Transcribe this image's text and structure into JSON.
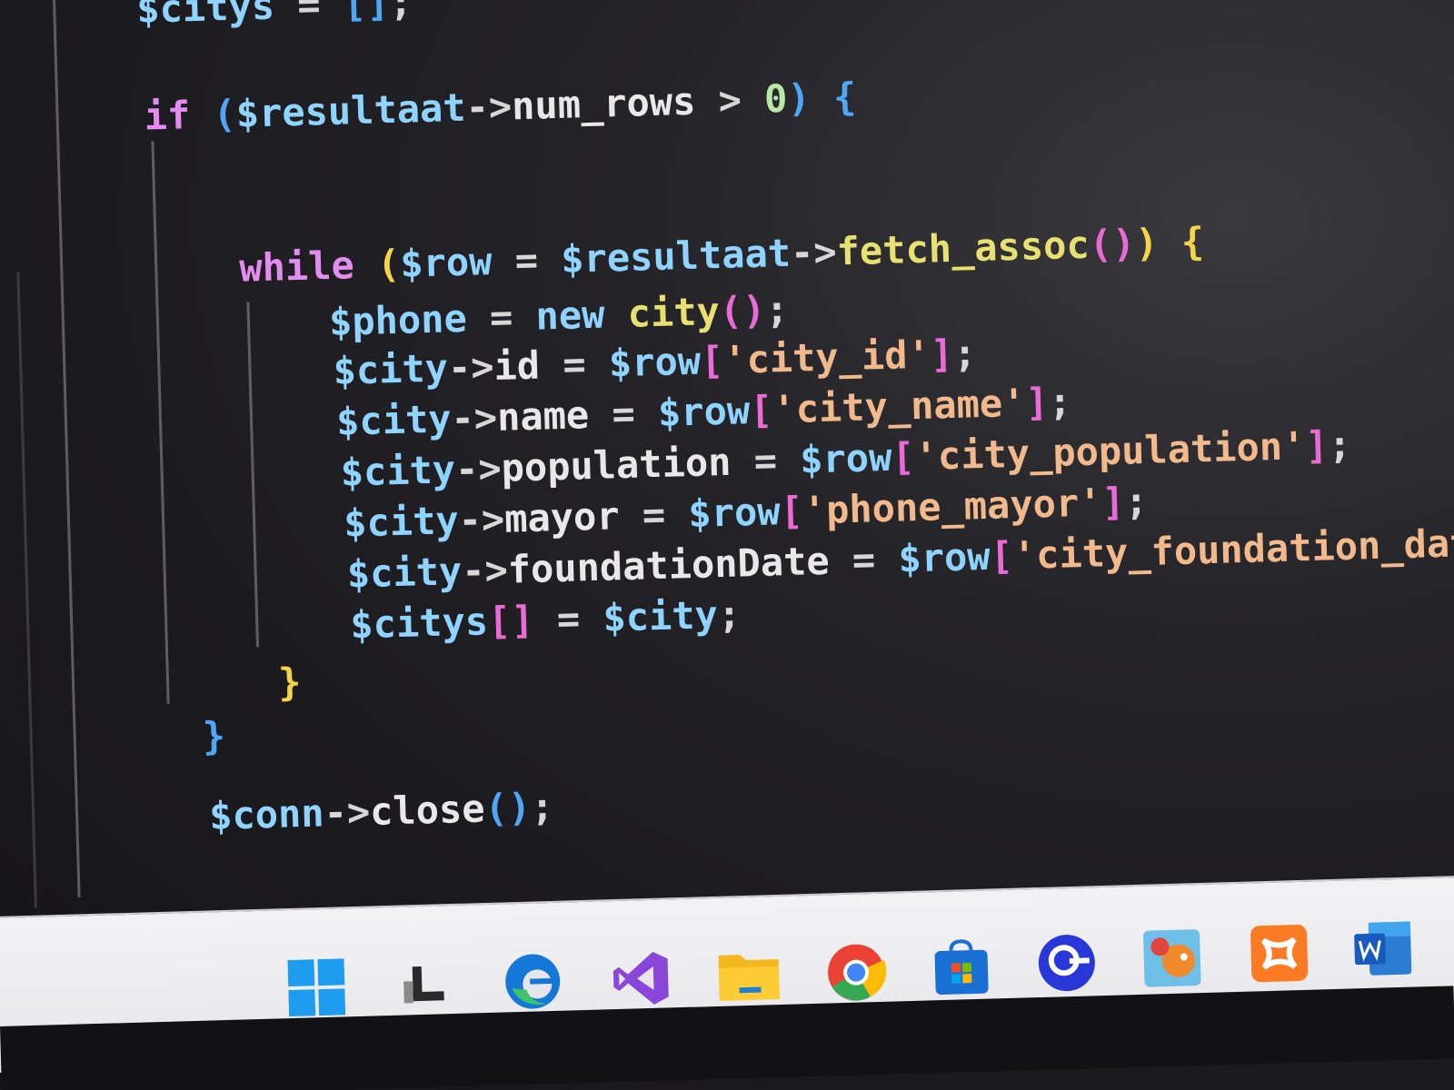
{
  "editor": {
    "lines": [
      [
        {
          "t": "$citys",
          "c": "var"
        },
        {
          "t": " = ",
          "c": "op"
        },
        {
          "t": "[]",
          "c": "b3"
        },
        {
          "t": ";",
          "c": "op"
        }
      ],
      [
        {
          "t": "if",
          "c": "kw"
        },
        {
          "t": " ",
          "c": "op"
        },
        {
          "t": "(",
          "c": "b3"
        },
        {
          "t": "$resultaat",
          "c": "var"
        },
        {
          "t": "->",
          "c": "op"
        },
        {
          "t": "num_rows",
          "c": "prop"
        },
        {
          "t": " > ",
          "c": "op"
        },
        {
          "t": "0",
          "c": "num"
        },
        {
          "t": ")",
          "c": "b3"
        },
        {
          "t": " ",
          "c": "op"
        },
        {
          "t": "{",
          "c": "b3"
        }
      ],
      [
        {
          "t": "while",
          "c": "kw"
        },
        {
          "t": " ",
          "c": "op"
        },
        {
          "t": "(",
          "c": "b1"
        },
        {
          "t": "$row",
          "c": "var"
        },
        {
          "t": " = ",
          "c": "op"
        },
        {
          "t": "$resultaat",
          "c": "var"
        },
        {
          "t": "->",
          "c": "op"
        },
        {
          "t": "fetch_assoc",
          "c": "fn"
        },
        {
          "t": "()",
          "c": "b2"
        },
        {
          "t": ")",
          "c": "b1"
        },
        {
          "t": " ",
          "c": "op"
        },
        {
          "t": "{",
          "c": "b1"
        }
      ],
      [
        {
          "t": "$phone",
          "c": "var"
        },
        {
          "t": " = ",
          "c": "op"
        },
        {
          "t": "new",
          "c": "var"
        },
        {
          "t": " ",
          "c": "op"
        },
        {
          "t": "city",
          "c": "fn"
        },
        {
          "t": "()",
          "c": "b2"
        },
        {
          "t": ";",
          "c": "op"
        }
      ],
      [
        {
          "t": "$city",
          "c": "var"
        },
        {
          "t": "->",
          "c": "op"
        },
        {
          "t": "id",
          "c": "prop"
        },
        {
          "t": " = ",
          "c": "op"
        },
        {
          "t": "$row",
          "c": "var"
        },
        {
          "t": "[",
          "c": "b2"
        },
        {
          "t": "'city_id'",
          "c": "str"
        },
        {
          "t": "]",
          "c": "b2"
        },
        {
          "t": ";",
          "c": "op"
        }
      ],
      [
        {
          "t": "$city",
          "c": "var"
        },
        {
          "t": "->",
          "c": "op"
        },
        {
          "t": "name",
          "c": "prop"
        },
        {
          "t": " = ",
          "c": "op"
        },
        {
          "t": "$row",
          "c": "var"
        },
        {
          "t": "[",
          "c": "b2"
        },
        {
          "t": "'city_name'",
          "c": "str"
        },
        {
          "t": "]",
          "c": "b2"
        },
        {
          "t": ";",
          "c": "op"
        }
      ],
      [
        {
          "t": "$city",
          "c": "var"
        },
        {
          "t": "->",
          "c": "op"
        },
        {
          "t": "population",
          "c": "prop"
        },
        {
          "t": " = ",
          "c": "op"
        },
        {
          "t": "$row",
          "c": "var"
        },
        {
          "t": "[",
          "c": "b2"
        },
        {
          "t": "'city_population'",
          "c": "str"
        },
        {
          "t": "]",
          "c": "b2"
        },
        {
          "t": ";",
          "c": "op"
        }
      ],
      [
        {
          "t": "$city",
          "c": "var"
        },
        {
          "t": "->",
          "c": "op"
        },
        {
          "t": "mayor",
          "c": "prop"
        },
        {
          "t": " = ",
          "c": "op"
        },
        {
          "t": "$row",
          "c": "var"
        },
        {
          "t": "[",
          "c": "b2"
        },
        {
          "t": "'phone_mayor'",
          "c": "str"
        },
        {
          "t": "]",
          "c": "b2"
        },
        {
          "t": ";",
          "c": "op"
        }
      ],
      [
        {
          "t": "$city",
          "c": "var"
        },
        {
          "t": "->",
          "c": "op"
        },
        {
          "t": "foundationDate",
          "c": "prop"
        },
        {
          "t": " = ",
          "c": "op"
        },
        {
          "t": "$row",
          "c": "var"
        },
        {
          "t": "[",
          "c": "b2"
        },
        {
          "t": "'city_foundation_date'",
          "c": "str"
        },
        {
          "t": "]",
          "c": "b2"
        },
        {
          "t": ";",
          "c": "op"
        }
      ],
      [
        {
          "t": "$citys",
          "c": "var"
        },
        {
          "t": "[]",
          "c": "b2"
        },
        {
          "t": " = ",
          "c": "op"
        },
        {
          "t": "$city",
          "c": "var"
        },
        {
          "t": ";",
          "c": "op"
        }
      ],
      [
        {
          "t": "}",
          "c": "b1"
        }
      ],
      [
        {
          "t": "}",
          "c": "b3"
        }
      ],
      [
        {
          "t": "$conn",
          "c": "var"
        },
        {
          "t": "->",
          "c": "op"
        },
        {
          "t": "close",
          "c": "prop"
        },
        {
          "t": "()",
          "c": "b3"
        },
        {
          "t": ";",
          "c": "op"
        }
      ]
    ]
  },
  "colors": {
    "var": "#8fd4ff",
    "kw": "#e48cf0",
    "fn": "#e8e070",
    "str": "#f1b98c",
    "num": "#b7e8a8",
    "op": "#d7d7d7",
    "prop": "#e8e8e8",
    "b1": "#f4d54a",
    "b2": "#ea6bd5",
    "b3": "#4ea6f5"
  },
  "taskbar": {
    "icons": [
      {
        "name": "windows-start-icon",
        "running": false
      },
      {
        "name": "task-view-icon",
        "running": false
      },
      {
        "name": "edge-browser-icon",
        "running": true
      },
      {
        "name": "visual-studio-icon",
        "running": false
      },
      {
        "name": "file-explorer-icon",
        "running": false
      },
      {
        "name": "chrome-browser-icon",
        "running": true
      },
      {
        "name": "microsoft-store-icon",
        "running": false
      },
      {
        "name": "search-app-icon",
        "running": false
      },
      {
        "name": "game-app-icon",
        "running": false
      },
      {
        "name": "xampp-icon",
        "running": true
      },
      {
        "name": "word-icon",
        "running": true
      }
    ]
  }
}
